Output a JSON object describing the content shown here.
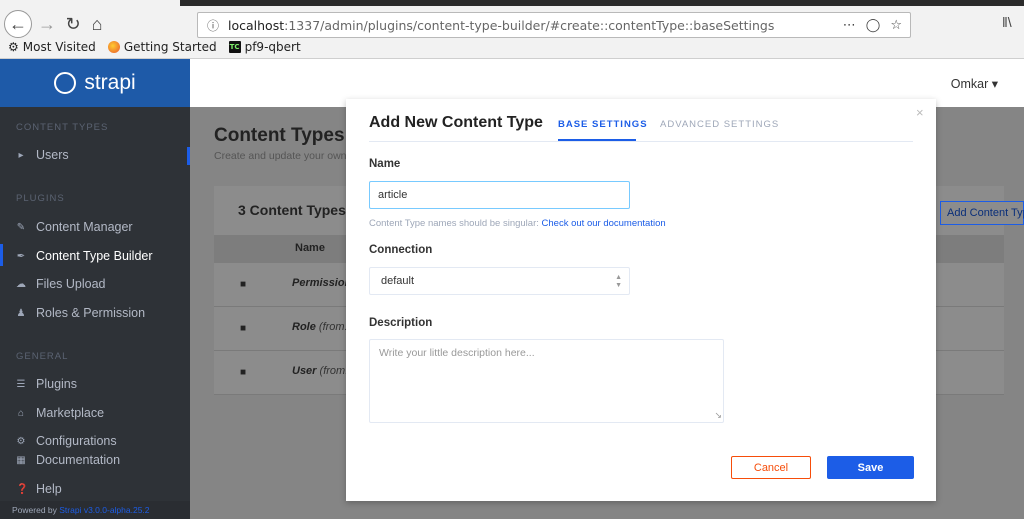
{
  "browser": {
    "url_host": "localhost",
    "url_rest": ":1337/admin/plugins/content-type-builder/#create::contentType::baseSettings",
    "bookmarks": [
      "Most Visited",
      "Getting Started",
      "pf9-qbert"
    ]
  },
  "sidebar": {
    "brand": "strapi",
    "sections": {
      "content_types": "CONTENT TYPES",
      "plugins": "PLUGINS",
      "general": "GENERAL"
    },
    "content_items": [
      "Users"
    ],
    "plugin_items": [
      "Content Manager",
      "Content Type Builder",
      "Files Upload",
      "Roles & Permission"
    ],
    "general_items": [
      "Plugins",
      "Marketplace",
      "Configurations",
      "Documentation",
      "Help"
    ],
    "footer_prefix": "Powered by",
    "footer_version": "Strapi v3.0.0-alpha.25.2"
  },
  "topbar": {
    "user": "Omkar"
  },
  "page": {
    "title": "Content Types",
    "subtitle": "Create and update your own C",
    "card_title": "3 Content Types a",
    "add_button": "Add Content Type",
    "column_name": "Name",
    "rows": [
      {
        "name": "Permission",
        "from": "("
      },
      {
        "name": "Role",
        "from": "(from: u"
      },
      {
        "name": "User",
        "from": "(from: u"
      }
    ]
  },
  "modal": {
    "title": "Add New Content Type",
    "tab_base": "BASE SETTINGS",
    "tab_advanced": "ADVANCED SETTINGS",
    "name_label": "Name",
    "name_value": "article",
    "hint_text": "Content Type names should be singular: ",
    "hint_link": "Check out our documentation",
    "connection_label": "Connection",
    "connection_value": "default",
    "description_label": "Description",
    "description_placeholder": "Write your little description here...",
    "cancel": "Cancel",
    "save": "Save"
  },
  "colors": {
    "primary": "#1c5de7",
    "danger": "#f64d0a",
    "sidebar": "#2e3237"
  }
}
